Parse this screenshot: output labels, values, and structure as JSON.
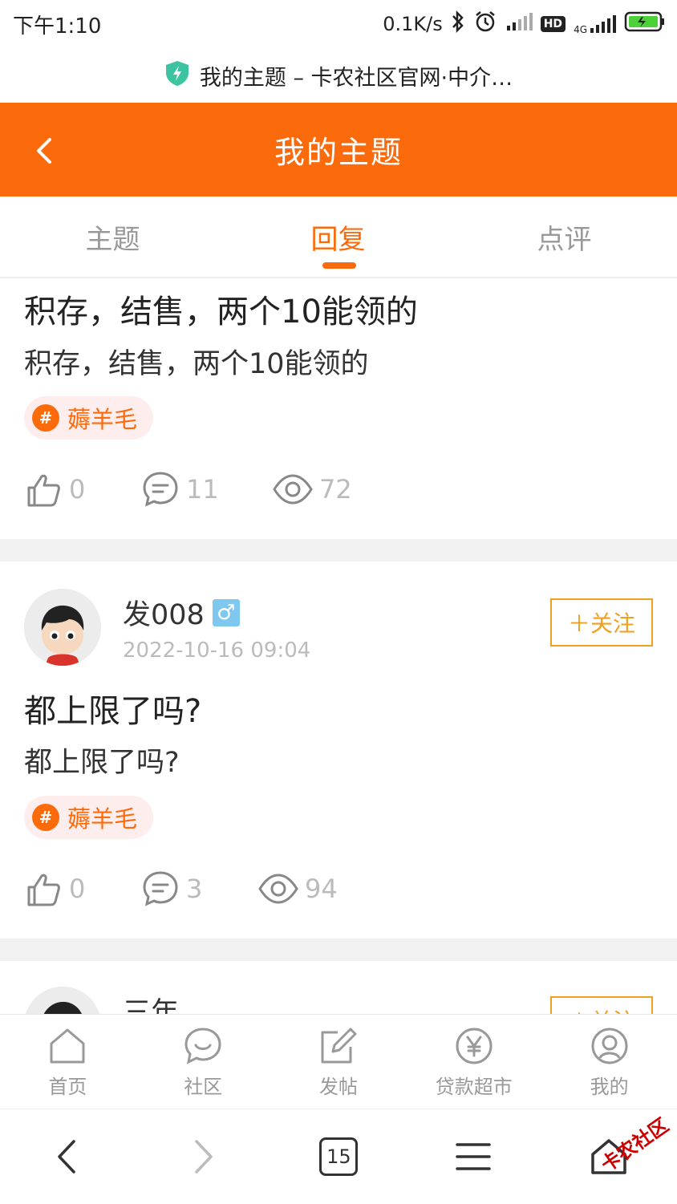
{
  "status_bar": {
    "time": "下午1:10",
    "net_speed": "0.1K/s",
    "icons": [
      "bluetooth-icon",
      "alarm-icon",
      "signal-icon",
      "hd-icon",
      "4g-signal-icon",
      "battery-icon"
    ],
    "net_type": "4G",
    "hd": "HD"
  },
  "browser": {
    "page_title": "我的主题 – 卡农社区官网·中介…",
    "tab_count": "15"
  },
  "header": {
    "title": "我的主题",
    "accent_color": "#fb6b0c"
  },
  "tabs": [
    {
      "label": "主题",
      "active": false
    },
    {
      "label": "回复",
      "active": true
    },
    {
      "label": "点评",
      "active": false
    }
  ],
  "posts": [
    {
      "title": "积存，结售，两个10能领的",
      "body": "积存，结售，两个10能领的",
      "tag": "薅羊毛",
      "likes": "0",
      "comments": "11",
      "views": "72"
    },
    {
      "username": "发008",
      "gender": "♂",
      "time": "2022-10-16 09:04",
      "follow_label": "＋关注",
      "title": "都上限了吗?",
      "body": "都上限了吗?",
      "tag": "薅羊毛",
      "likes": "0",
      "comments": "3",
      "views": "94"
    },
    {
      "username": "三年",
      "follow_label": "＋关注"
    }
  ],
  "bottom_nav": [
    {
      "label": "首页",
      "icon": "home-icon"
    },
    {
      "label": "社区",
      "icon": "chat-icon"
    },
    {
      "label": "发帖",
      "icon": "edit-icon"
    },
    {
      "label": "贷款超市",
      "icon": "yuan-icon"
    },
    {
      "label": "我的",
      "icon": "user-icon"
    }
  ],
  "watermark": "卡农社区"
}
